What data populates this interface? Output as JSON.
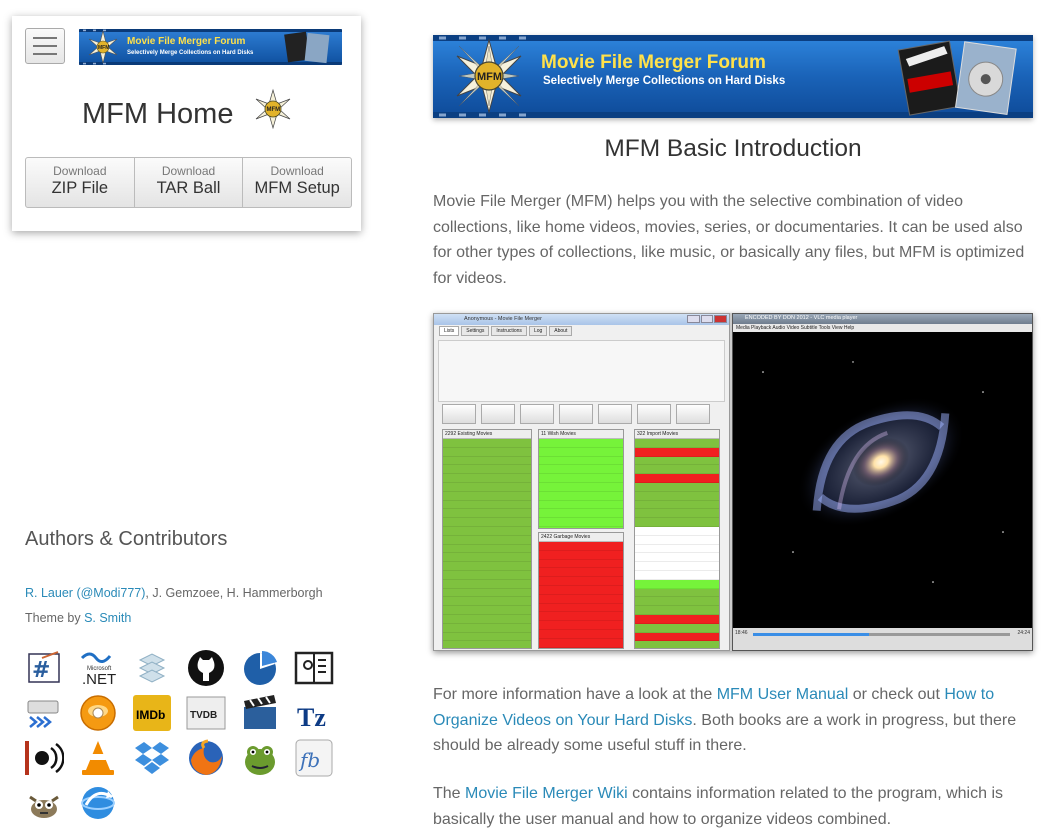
{
  "header": {
    "menu_label": "Menu",
    "banner_title": "Movie File Merger Forum",
    "banner_subtitle": "Selectively Merge Collections on Hard Disks",
    "logo_text": "MFM",
    "home_title": "MFM Home"
  },
  "downloads": [
    {
      "small": "Download",
      "big": "ZIP File"
    },
    {
      "small": "Download",
      "big": "TAR Ball"
    },
    {
      "small": "Download",
      "big": "MFM Setup"
    }
  ],
  "authors": {
    "heading": "Authors & Contributors",
    "author_link": "R. Lauer",
    "author_handle_link": "(@Modi777)",
    "coauthors": ", J. Gemzoee, H. Hammerborgh",
    "theme_prefix": "Theme by ",
    "theme_link": "S. Smith"
  },
  "tool_icons": [
    "sharpdevelop-icon",
    "dotnet-icon",
    "stack-icon",
    "github-icon",
    "piechart-icon",
    "book-icon",
    "drive-icon",
    "vlc-orb-icon",
    "imdb-icon",
    "tvdb-icon",
    "clapperboard-icon",
    "tz-icon",
    "audio-icon",
    "vlc-cone-icon",
    "dropbox-icon",
    "firefox-icon",
    "frog-icon",
    "fb-icon",
    "gimp-icon",
    "refresh-globe-icon"
  ],
  "icon_text": {
    "net_top": "Microsoft",
    "net_big": ".NET",
    "imdb": "IMDb",
    "tvdb": "TVDB",
    "tz": "Tz",
    "fb": "fb"
  },
  "main": {
    "title": "MFM Basic Introduction",
    "intro": "Movie File Merger (MFM) helps you with the selective combination of video collections, like home videos, movies, series, or documentaries. It can be used also for other types of collections, like music, or basically any files, but MFM is optimized for videos.",
    "p2_a": "For more information have a look at the ",
    "p2_link1": "MFM User Manual",
    "p2_b": " or check out ",
    "p2_link2": "How to Organize Videos on Your Hard Disks",
    "p2_c": ". Both books are a work in progress, but there should be already some useful stuff in there.",
    "p3_a": "The ",
    "p3_link": "Movie File Merger Wiki",
    "p3_b": " contains information related to the program, which is basically the user manual and how to organize videos combined."
  },
  "screenshot": {
    "mfm_title": "Anonymous - Movie File Merger",
    "tabs": [
      "Lists",
      "Settings",
      "Instructions",
      "Log",
      "About"
    ],
    "col1_header": "2292 Existing Movies",
    "col2_header": "11 Wish Movies",
    "col2b_header": "2422 Garbage Movies",
    "col3_header": "322 Import Movies",
    "vlc_title": "ENCODED BY DON 2012 - VLC media player",
    "vlc_menu": "Media  Playback  Audio  Video  Subtitle  Tools  View  Help",
    "vlc_time_left": "18:46",
    "vlc_time_right": "24:24"
  },
  "colors": {
    "link": "#2a8ab8",
    "banner_blue": "#1a5fb4",
    "banner_yellow": "#ffe14a"
  }
}
